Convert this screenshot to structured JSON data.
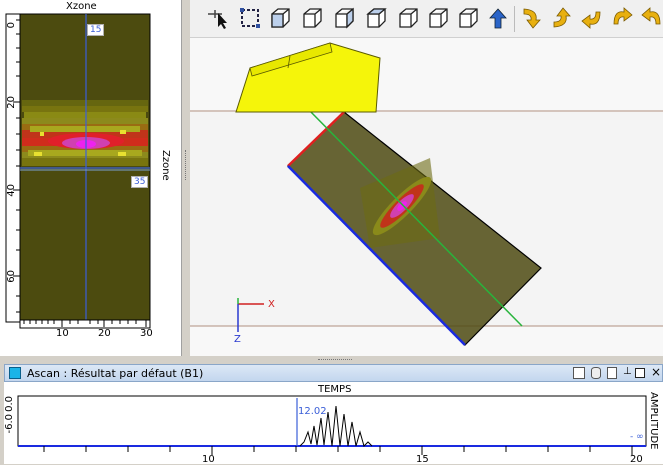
{
  "bscan": {
    "x_label": "Xzone",
    "z_label": "Zzone",
    "x_ticks": [
      "10",
      "20",
      "30"
    ],
    "z_ticks": [
      "0",
      "20",
      "40",
      "60"
    ],
    "cursor_x_value": "15",
    "cursor_z_value": "35"
  },
  "view3d": {
    "axis_x_label": "X",
    "axis_z_label": "Z",
    "toolbar_icons": [
      "select-arrow-icon",
      "zoom-box-icon",
      "cube-view-1-icon",
      "cube-view-2-icon",
      "cube-view-3-icon",
      "cube-view-4-icon",
      "cube-view-5-icon",
      "cube-view-6-icon",
      "cube-view-7-icon",
      "up-arrow-icon",
      "rotate-down-icon",
      "rotate-up-icon",
      "rotate-left-icon",
      "rotate-right-icon",
      "rotate-undo-icon"
    ]
  },
  "ascan": {
    "title": "Ascan : Résultat par défaut (B1)",
    "x_label": "TEMPS",
    "y_label": "AMPLITUDE",
    "y_tick": "-6.0",
    "y_tick2": "0.0",
    "cursor_value": "12.02",
    "min_value": "- ∞",
    "x_ticks": [
      "10",
      "15",
      "20"
    ]
  },
  "colors": {
    "zone_fill": "#4c4b0f",
    "cursor_blue": "#3b5fd8",
    "cursor_green": "#28b43c",
    "probe_yellow": "#f5f50a"
  }
}
